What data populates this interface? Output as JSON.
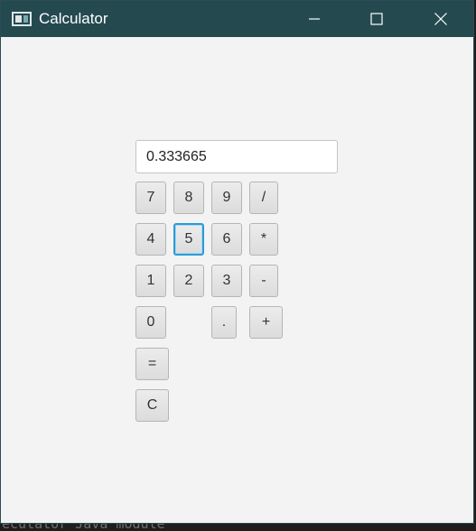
{
  "window": {
    "title": "Calculator"
  },
  "display": {
    "value": "0.333665"
  },
  "keys": {
    "seven": "7",
    "eight": "8",
    "nine": "9",
    "divide": "/",
    "four": "4",
    "five": "5",
    "six": "6",
    "multiply": "*",
    "one": "1",
    "two": "2",
    "three": "3",
    "subtract": "-",
    "zero": "0",
    "decimal": ".",
    "add": "+",
    "equals": "=",
    "clear": "C"
  },
  "focused_key": "5",
  "background_terminal_text": "ecutator  Java module",
  "colors": {
    "titlebar": "#244a50",
    "focus_ring": "#2b9bd8",
    "window_background": "#f3f3f3"
  }
}
